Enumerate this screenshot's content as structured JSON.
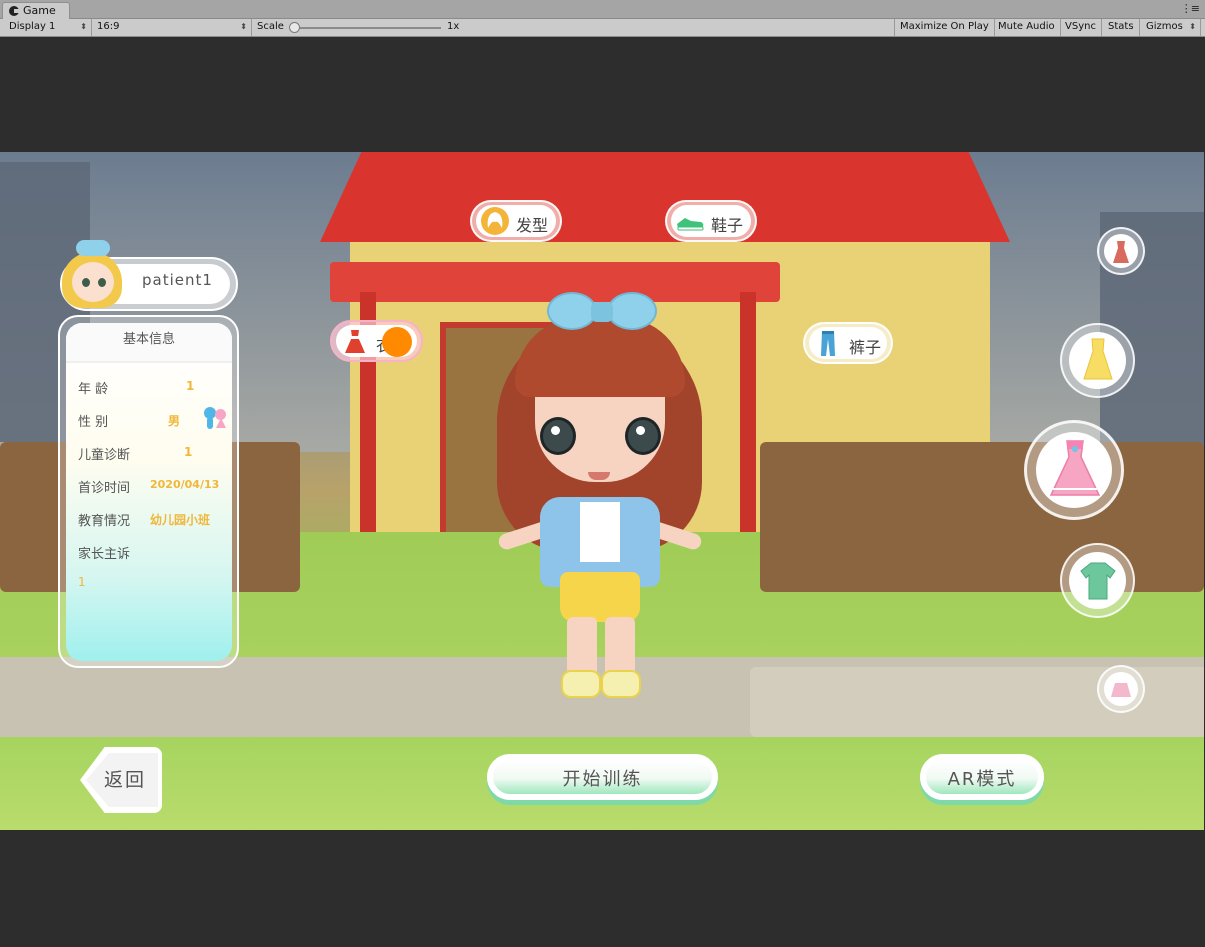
{
  "editor": {
    "tab_title": "Game",
    "tab_menu": "⋮≡",
    "display": "Display 1",
    "aspect": "16:9",
    "scale_label": "Scale",
    "scale_value": "1x",
    "maximize": "Maximize On Play",
    "mute": "Mute Audio",
    "vsync": "VSync",
    "stats": "Stats",
    "gizmos": "Gizmos"
  },
  "patient": {
    "name": "patient1",
    "avatar_icon": "girl-avatar-icon"
  },
  "info": {
    "header": "基本信息",
    "rows": [
      {
        "label": "年    龄",
        "value": "1"
      },
      {
        "label": "性    别",
        "value": "男"
      },
      {
        "label": "儿童诊断",
        "value": "1"
      },
      {
        "label": "首诊时间",
        "value": "2020/04/13"
      },
      {
        "label": "教育情况",
        "value": "幼儿园小班"
      },
      {
        "label": "家长主诉",
        "value": ""
      }
    ],
    "complaint": "1",
    "gender_icon": "boy-girl-icon"
  },
  "categories": {
    "hair": {
      "label": "发型",
      "icon": "hair-icon"
    },
    "shoes": {
      "label": "鞋子",
      "icon": "sneaker-icon"
    },
    "clothes": {
      "label": "衣",
      "icon": "dress-icon"
    },
    "pants": {
      "label": "裤子",
      "icon": "pants-icon"
    }
  },
  "outfits": [
    {
      "icon": "red-dress-icon"
    },
    {
      "icon": "yellow-dress-icon"
    },
    {
      "icon": "pink-dress-icon",
      "selected": true
    },
    {
      "icon": "green-shirt-icon"
    },
    {
      "icon": "pink-skirt-icon"
    }
  ],
  "buttons": {
    "back": "返回",
    "start": "开始训练",
    "ar": "AR模式"
  },
  "colors": {
    "accent_green": "#9fe7bd",
    "value_orange": "#f0b73a",
    "roof_red": "#d9352e",
    "indicator": "#ff8a00"
  }
}
